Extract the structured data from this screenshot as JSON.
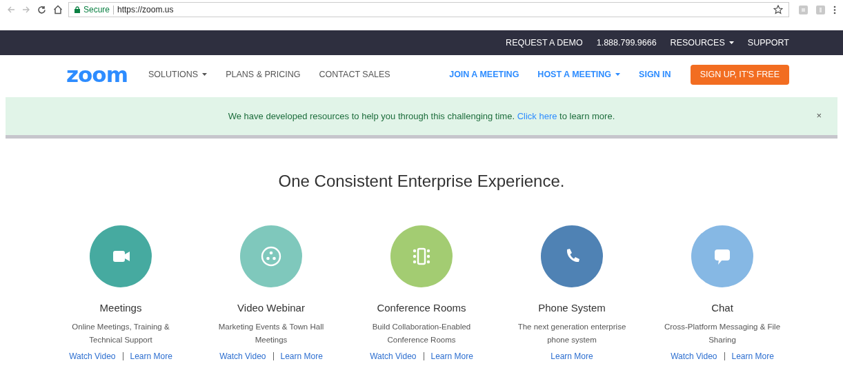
{
  "browser": {
    "secure_label": "Secure",
    "url": "https://zoom.us"
  },
  "top_bar": {
    "items": [
      {
        "label": "REQUEST A DEMO",
        "dropdown": false
      },
      {
        "label": "1.888.799.9666",
        "dropdown": false
      },
      {
        "label": "RESOURCES",
        "dropdown": true
      },
      {
        "label": "SUPPORT",
        "dropdown": false
      }
    ]
  },
  "nav": {
    "logo": "zoom",
    "left_items": [
      {
        "label": "SOLUTIONS",
        "dropdown": true
      },
      {
        "label": "PLANS & PRICING",
        "dropdown": false
      },
      {
        "label": "CONTACT SALES",
        "dropdown": false
      }
    ],
    "right_items": [
      {
        "label": "JOIN A MEETING",
        "dropdown": false
      },
      {
        "label": "HOST A MEETING",
        "dropdown": true
      },
      {
        "label": "SIGN IN",
        "dropdown": false
      }
    ],
    "cta": "SIGN UP, IT'S FREE"
  },
  "banner": {
    "text_before": "We have developed resources to help you through this challenging time.",
    "link": "Click here",
    "text_after": "to learn more.",
    "close": "×"
  },
  "headline": "One Consistent Enterprise Experience.",
  "products": [
    {
      "kind": "camera",
      "color": "#46aaa0",
      "title": "Meetings",
      "description": "Online Meetings, Training & Technical Support",
      "links": [
        "Watch Video",
        "Learn More"
      ]
    },
    {
      "kind": "webinar",
      "color": "#7fc8bc",
      "title": "Video Webinar",
      "description": "Marketing Events & Town Hall Meetings",
      "links": [
        "Watch Video",
        "Learn More"
      ]
    },
    {
      "kind": "rooms",
      "color": "#a3cc72",
      "title": "Conference Rooms",
      "description": "Build Collaboration-Enabled Conference Rooms",
      "links": [
        "Watch Video",
        "Learn More"
      ]
    },
    {
      "kind": "phone",
      "color": "#4f82b4",
      "title": "Phone System",
      "description": "The next generation enterprise phone system",
      "links": [
        "Learn More"
      ]
    },
    {
      "kind": "chat",
      "color": "#86b8e4",
      "title": "Chat",
      "description": "Cross-Platform Messaging & File Sharing",
      "links": [
        "Watch Video",
        "Learn More"
      ]
    }
  ]
}
